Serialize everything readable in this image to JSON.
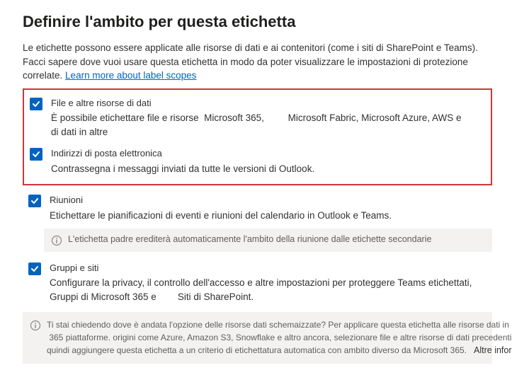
{
  "title": "Definire l'ambito per questa etichetta",
  "intro_text": "Le etichette possono essere applicate alle risorse di dati e ai contenitori (come i siti di SharePoint e Teams). Facci sapere dove vuoi usare questa etichetta in modo da poter visualizzare le impostazioni di protezione correlate.",
  "intro_link": "Learn more about label scopes",
  "options": {
    "files": {
      "label": "File e altre risorse di dati",
      "desc_prefix": "È possibile etichettare file e risorse ",
      "desc_ms365": " Microsoft 365, ",
      "desc_rest": "        Microsoft Fabric, Microsoft Azure, AWS e",
      "desc_line2": "di dati in altre"
    },
    "email": {
      "label": "Indirizzi di posta elettronica",
      "desc": "Contrassegna i messaggi inviati da tutte le versioni di Outlook."
    },
    "meetings": {
      "label": "Riunioni",
      "desc": "Etichettare le pianificazioni di eventi e riunioni del calendario in Outlook e Teams."
    },
    "meetings_note": "L'etichetta padre erediterà automaticamente l'ambito della riunione dalle etichette secondarie",
    "groups": {
      "label": "Gruppi e siti",
      "desc_1": "Configurare la privacy, il controllo dell'accesso e altre impostazioni per proteggere Teams etichettati,",
      "desc_2a": "Gruppi di Microsoft 365 e ",
      "desc_2b": "       Siti di SharePoint."
    }
  },
  "footer": {
    "line1": "Ti stai chiedendo dove è andata l'opzione delle risorse dati schemaizzate? Per applicare questa etichetta alle risorse dati in",
    "line2a": " 365 ",
    "line2b": "piattaforme. origini come Azure, Amazon S3, Snowflake e altro ancora, selezionare file e altre risorse di dati precedenti e",
    "line3": "quindi aggiungere questa etichetta a un criterio di etichettatura automatica con ambito diverso da Microsoft 365.",
    "more": "Altre informazioni"
  }
}
